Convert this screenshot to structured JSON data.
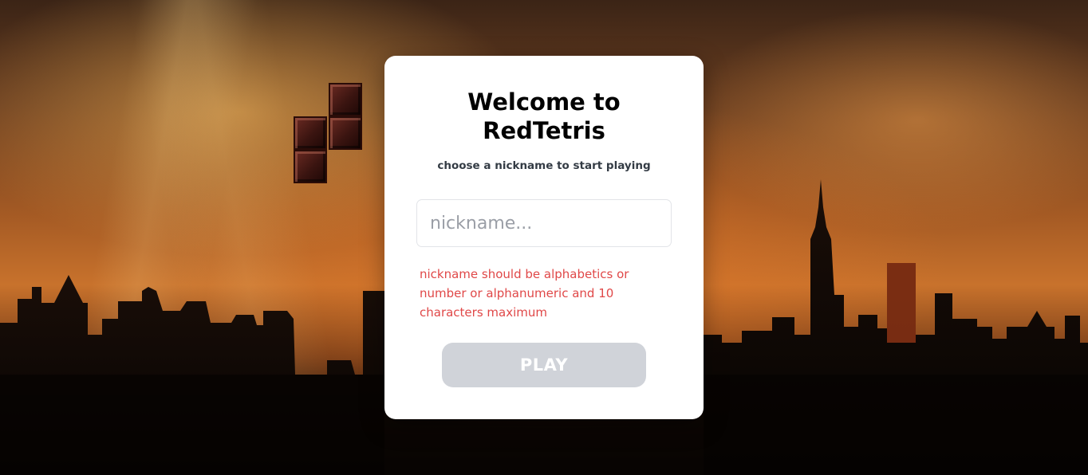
{
  "card": {
    "title": "Welcome to\nRedTetris",
    "subtitle": "choose a nickname to start playing",
    "nickname_placeholder": "nickname...",
    "nickname_value": "",
    "error_message": "nickname should be alphabetics or number or alphanumeric and 10 characters maximum",
    "play_label": "PLAY"
  },
  "colors": {
    "error": "#e04848",
    "button_disabled": "#d0d3d9",
    "card_background": "#ffffff"
  },
  "background": {
    "icons": [
      "sunset-city-skyline",
      "tetromino-blocks"
    ]
  }
}
